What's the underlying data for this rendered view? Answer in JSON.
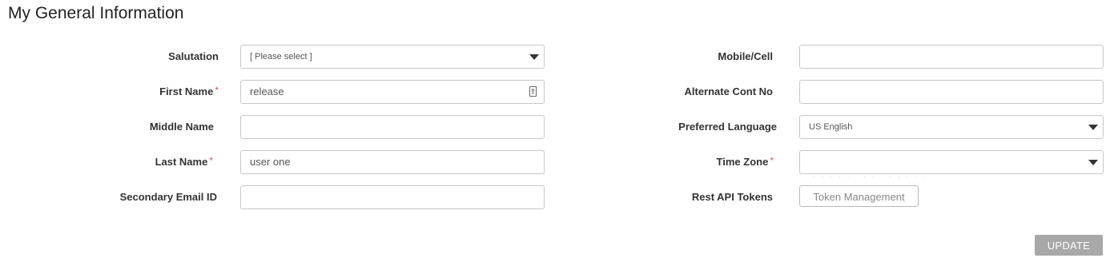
{
  "page": {
    "title": "My General Information"
  },
  "left_fields": {
    "salutation": {
      "label": "Salutation",
      "value": "[ Please select ]",
      "required": false
    },
    "first_name": {
      "label": "First Name",
      "value": "release",
      "required": true
    },
    "middle_name": {
      "label": "Middle Name",
      "value": "",
      "required": false
    },
    "last_name": {
      "label": "Last Name",
      "value": "user one",
      "required": true
    },
    "secondary_email": {
      "label": "Secondary Email ID",
      "value": "",
      "required": false
    }
  },
  "right_fields": {
    "mobile": {
      "label": "Mobile/Cell",
      "value": ""
    },
    "alternate": {
      "label": "Alternate Cont No",
      "value": ""
    },
    "language": {
      "label": "Preferred Language",
      "value": "US English"
    },
    "time_zone": {
      "label": "Time Zone",
      "value": "",
      "required": true
    },
    "rest_api": {
      "label": "Rest API Tokens",
      "button": "Token Management"
    }
  },
  "required_marker": "*",
  "actions": {
    "update": "UPDATE"
  },
  "icons": {
    "dropdown": "caret-down-icon",
    "keyboard": "keypad-icon"
  },
  "colors": {
    "required": "#d9534f",
    "update_button": "#a8a8a8",
    "border": "#c8c8c8"
  }
}
